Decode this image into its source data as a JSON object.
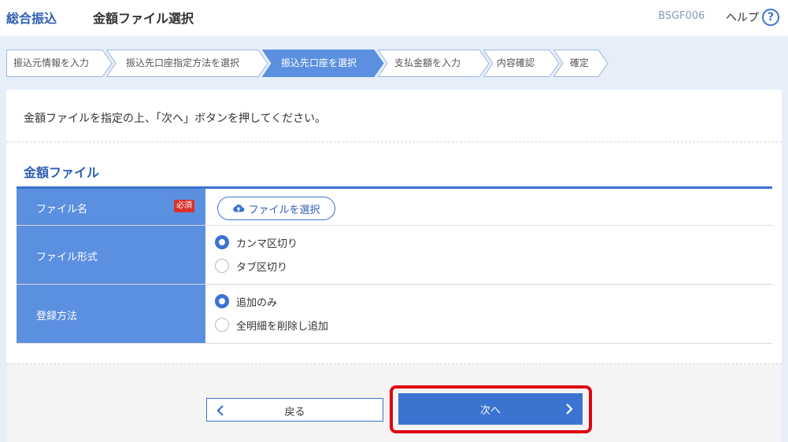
{
  "header": {
    "app_name": "総合振込",
    "screen_title": "金額ファイル選択",
    "screen_code": "BSGF006",
    "help_label": "ヘルプ",
    "help_icon": "question-circle-icon"
  },
  "steps": [
    {
      "label": "振込元情報を入力",
      "active": false
    },
    {
      "label": "振込先口座指定方法を選択",
      "active": false
    },
    {
      "label": "振込先口座を選択",
      "active": true
    },
    {
      "label": "支払金額を入力",
      "active": false
    },
    {
      "label": "内容確認",
      "active": false
    },
    {
      "label": "確定",
      "active": false
    }
  ],
  "instruction": "金額ファイルを指定の上、「次へ」ボタンを押してください。",
  "section_title": "金額ファイル",
  "form": {
    "file_name": {
      "label": "ファイル名",
      "required_badge": "必須",
      "button_label": "ファイルを選択",
      "button_icon": "cloud-upload-icon"
    },
    "file_format": {
      "label": "ファイル形式",
      "options": [
        {
          "label": "カンマ区切り",
          "selected": true
        },
        {
          "label": "タブ区切り",
          "selected": false
        }
      ]
    },
    "registration_method": {
      "label": "登録方法",
      "options": [
        {
          "label": "追加のみ",
          "selected": true
        },
        {
          "label": "全明細を削除し追加",
          "selected": false
        }
      ]
    }
  },
  "footer": {
    "back_label": "戻る",
    "next_label": "次へ"
  },
  "colors": {
    "accent": "#3b73d1",
    "label_bg": "#5b8fe0",
    "required": "#d9322b",
    "highlight": "#e0000f",
    "page_bg": "#e6eefa"
  }
}
